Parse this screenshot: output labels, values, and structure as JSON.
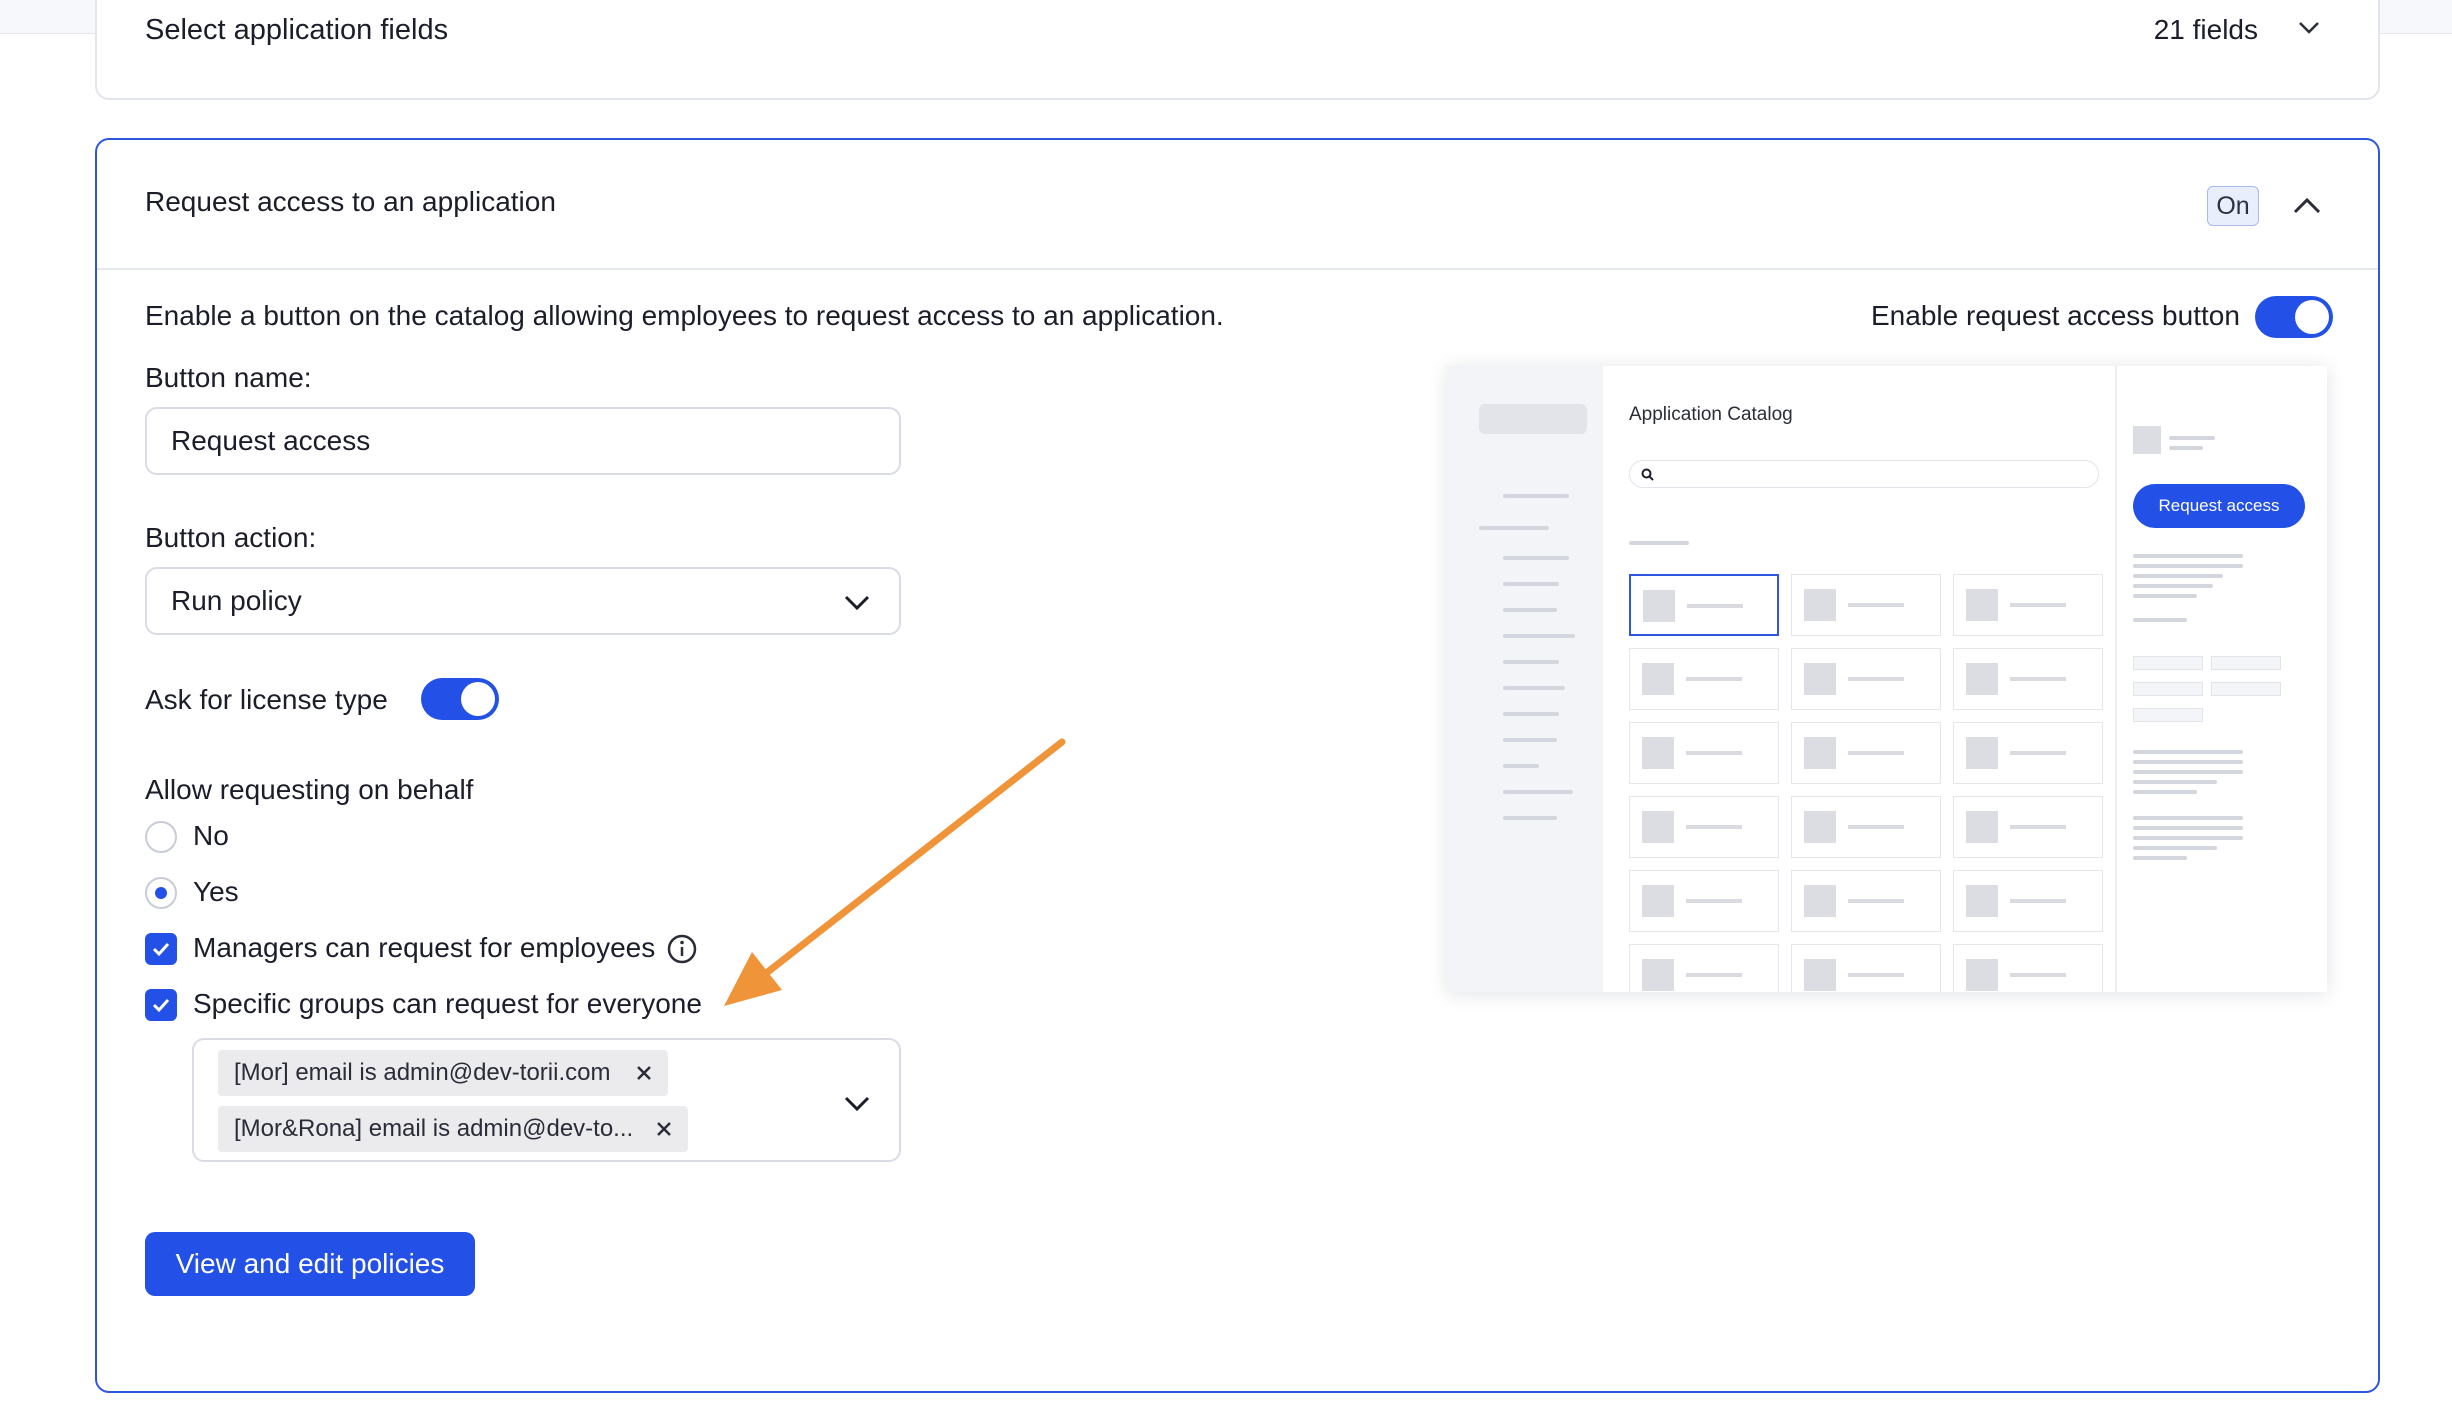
{
  "previous_section": {
    "title": "Select application fields",
    "count": "21 fields"
  },
  "section": {
    "title": "Request access to an application",
    "status_badge": "On",
    "description": "Enable a button on the catalog allowing employees to request access to an application.",
    "enable_label": "Enable request access button",
    "enable_toggle": "on"
  },
  "form": {
    "button_name_label": "Button name:",
    "button_name_value": "Request access",
    "button_action_label": "Button action:",
    "button_action_value": "Run policy",
    "license_label": "Ask for license type",
    "license_toggle": "on",
    "behalf_label": "Allow requesting on behalf",
    "behalf_options": [
      {
        "label": "No",
        "selected": false
      },
      {
        "label": "Yes",
        "selected": true
      }
    ],
    "checkboxes": [
      {
        "label": "Managers can request for employees",
        "checked": true
      },
      {
        "label": "Specific groups can request for everyone",
        "checked": true
      }
    ],
    "groups": [
      {
        "label": "[Mor] email is admin@dev-torii.com"
      },
      {
        "label": "[Mor&Rona] email is admin@dev-to..."
      }
    ],
    "policies_button": "View and edit policies"
  },
  "preview": {
    "title": "Application Catalog",
    "button": "Request access"
  },
  "colors": {
    "accent": "#2351e8",
    "annotation_arrow": "#f0943a"
  }
}
